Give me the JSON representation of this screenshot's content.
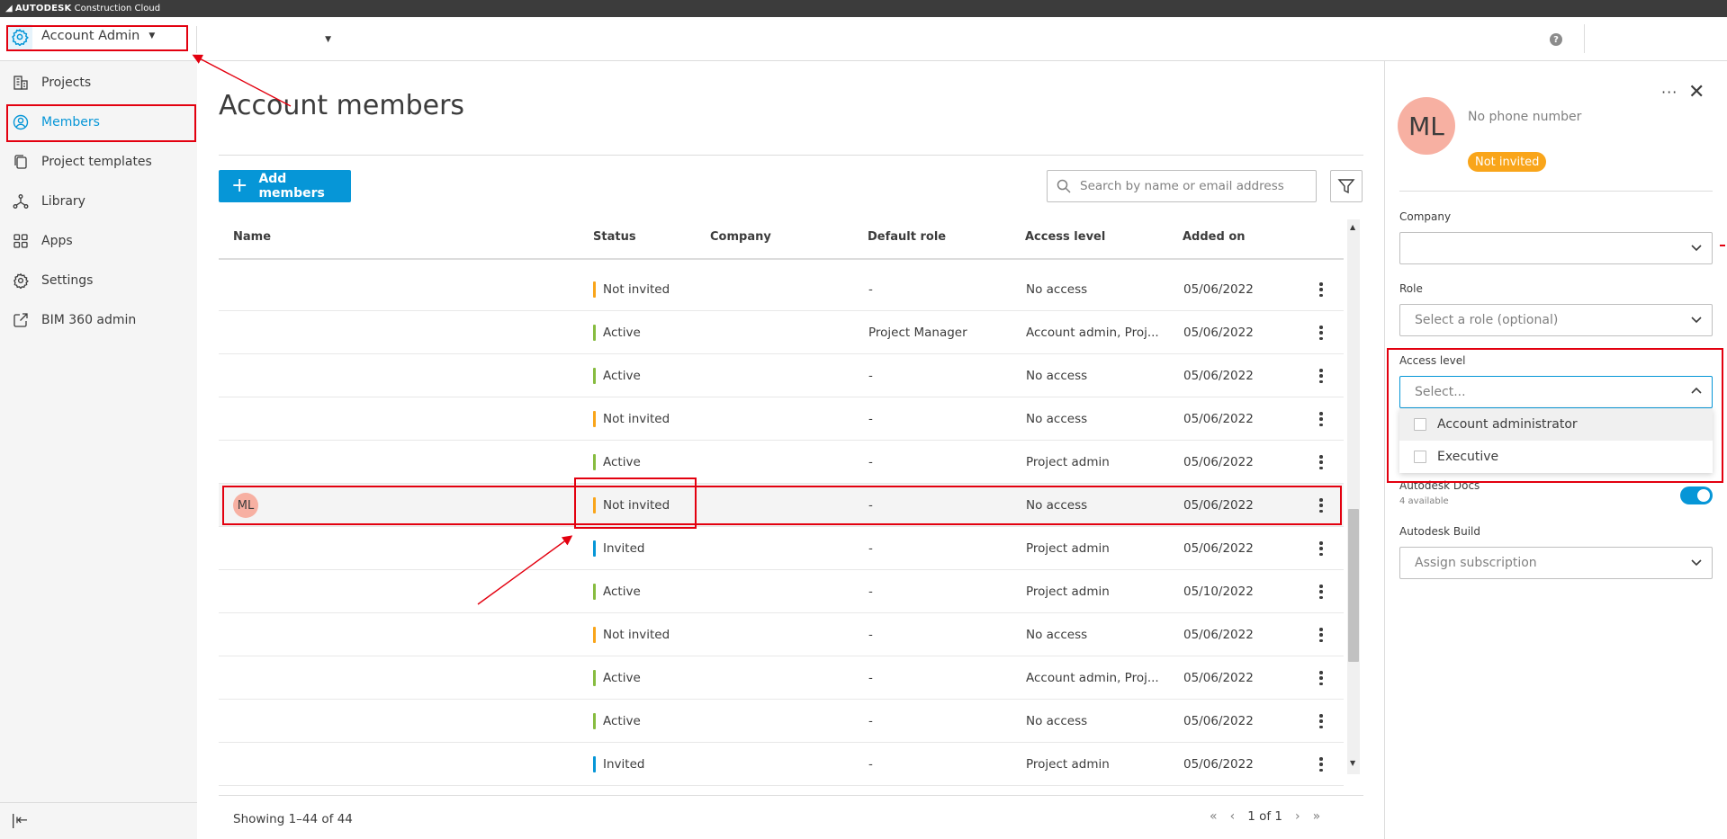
{
  "brand": {
    "bold": "AUTODESK",
    "rest": "Construction Cloud"
  },
  "header": {
    "module": "Account Admin",
    "project_selector": "",
    "help_icon": "help-icon"
  },
  "sidebar": {
    "items": [
      {
        "label": "Projects",
        "icon": "building-icon"
      },
      {
        "label": "Members",
        "icon": "user-icon",
        "active": true
      },
      {
        "label": "Project templates",
        "icon": "copy-icon"
      },
      {
        "label": "Library",
        "icon": "nodes-icon"
      },
      {
        "label": "Apps",
        "icon": "grid-icon"
      },
      {
        "label": "Settings",
        "icon": "gear-icon"
      },
      {
        "label": "BIM 360 admin",
        "icon": "external-link-icon"
      }
    ],
    "collapse_icon": "collapse-icon"
  },
  "main": {
    "title": "Account members",
    "add_button": "Add members",
    "search_placeholder": "Search by name or email address",
    "columns": [
      "Name",
      "Status",
      "Company",
      "Default role",
      "Access level",
      "Added on"
    ],
    "rows": [
      {
        "initials": "",
        "status": "Not invited",
        "status_color": "#f9a51a",
        "role": "-",
        "access": "No access",
        "added": "05/06/2022"
      },
      {
        "initials": "",
        "status": "Active",
        "status_color": "#87bc40",
        "role": "Project Manager",
        "access": "Account admin, Proj...",
        "added": "05/06/2022"
      },
      {
        "initials": "",
        "status": "Active",
        "status_color": "#87bc40",
        "role": "-",
        "access": "No access",
        "added": "05/06/2022"
      },
      {
        "initials": "",
        "status": "Not invited",
        "status_color": "#f9a51a",
        "role": "-",
        "access": "No access",
        "added": "05/06/2022"
      },
      {
        "initials": "",
        "status": "Active",
        "status_color": "#87bc40",
        "role": "-",
        "access": "Project admin",
        "added": "05/06/2022"
      },
      {
        "initials": "ML",
        "status": "Not invited",
        "status_color": "#f9a51a",
        "role": "-",
        "access": "No access",
        "added": "05/06/2022",
        "selected": true
      },
      {
        "initials": "",
        "status": "Invited",
        "status_color": "#0696d7",
        "role": "-",
        "access": "Project admin",
        "added": "05/06/2022"
      },
      {
        "initials": "",
        "status": "Active",
        "status_color": "#87bc40",
        "role": "-",
        "access": "Project admin",
        "added": "05/10/2022"
      },
      {
        "initials": "",
        "status": "Not invited",
        "status_color": "#f9a51a",
        "role": "-",
        "access": "No access",
        "added": "05/06/2022"
      },
      {
        "initials": "",
        "status": "Active",
        "status_color": "#87bc40",
        "role": "-",
        "access": "Account admin, Proj...",
        "added": "05/06/2022"
      },
      {
        "initials": "",
        "status": "Active",
        "status_color": "#87bc40",
        "role": "-",
        "access": "No access",
        "added": "05/06/2022"
      },
      {
        "initials": "",
        "status": "Invited",
        "status_color": "#0696d7",
        "role": "-",
        "access": "Project admin",
        "added": "05/06/2022"
      }
    ],
    "footer": {
      "showing": "Showing 1–44 of 44",
      "page": "1 of 1"
    }
  },
  "panel": {
    "initials": "ML",
    "phone": "No phone number",
    "badge": "Not invited",
    "badge_color": "#f9a51a",
    "company_label": "Company",
    "company_value": "",
    "role_label": "Role",
    "role_placeholder": "Select a role (optional)",
    "access_label": "Access level",
    "access_placeholder": "Select...",
    "access_options": [
      "Account administrator",
      "Executive"
    ],
    "docs_label": "Autodesk Docs",
    "docs_sub": "4 available",
    "build_label": "Autodesk Build",
    "build_placeholder": "Assign subscription"
  },
  "colors": {
    "accent": "#0696d7",
    "annotation": "#e3000f",
    "avatar": "#f7b0a2"
  }
}
